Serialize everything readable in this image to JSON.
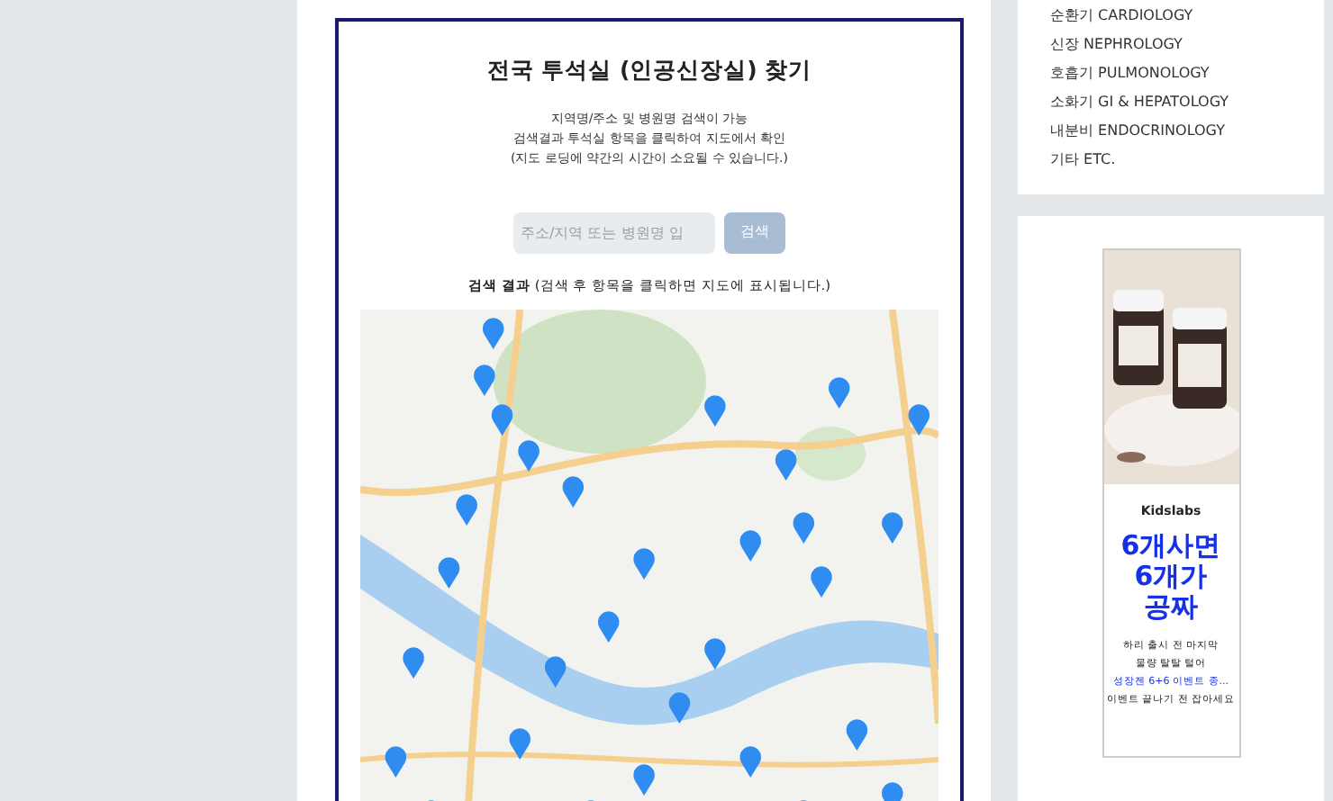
{
  "finder": {
    "title": "전국 투석실 (인공신장실) 찾기",
    "description": [
      "지역명/주소 및 병원명 검색이 가능",
      "검색결과 투석실 항목을 클릭하여 지도에서 확인",
      "(지도 로딩에 약간의 시간이 소요될 수 있습니다.)"
    ],
    "search": {
      "placeholder": "주소/지역 또는 병원명 입",
      "button": "검색",
      "disabled": true
    },
    "results_label": "**검색 결과** (검색 후 항목을 클릭하면 지도에 표시됩니다.)",
    "map": {
      "kind": "picture"
    }
  },
  "categories": [
    "순환기 CARDIOLOGY",
    "신장 NEPHROLOGY",
    "호흡기 PULMONOLOGY",
    "소화기 GI & HEPATOLOGY",
    "내분비 ENDOCRINOLOGY",
    "기타 ETC."
  ],
  "ad": {
    "brand": "Kidslabs",
    "headline": [
      "6개사면",
      "6개가",
      "공짜"
    ],
    "lines": [
      {
        "text": "하리 출시 전 마지막",
        "kind": "plain"
      },
      {
        "text": "물량 탈탈 털어",
        "kind": "plain"
      },
      {
        "text": "성장젠 6+6 이벤트 종...",
        "kind": "link"
      },
      {
        "text": "이벤트 끝나기 전 잡아세요",
        "kind": "plain"
      }
    ]
  }
}
